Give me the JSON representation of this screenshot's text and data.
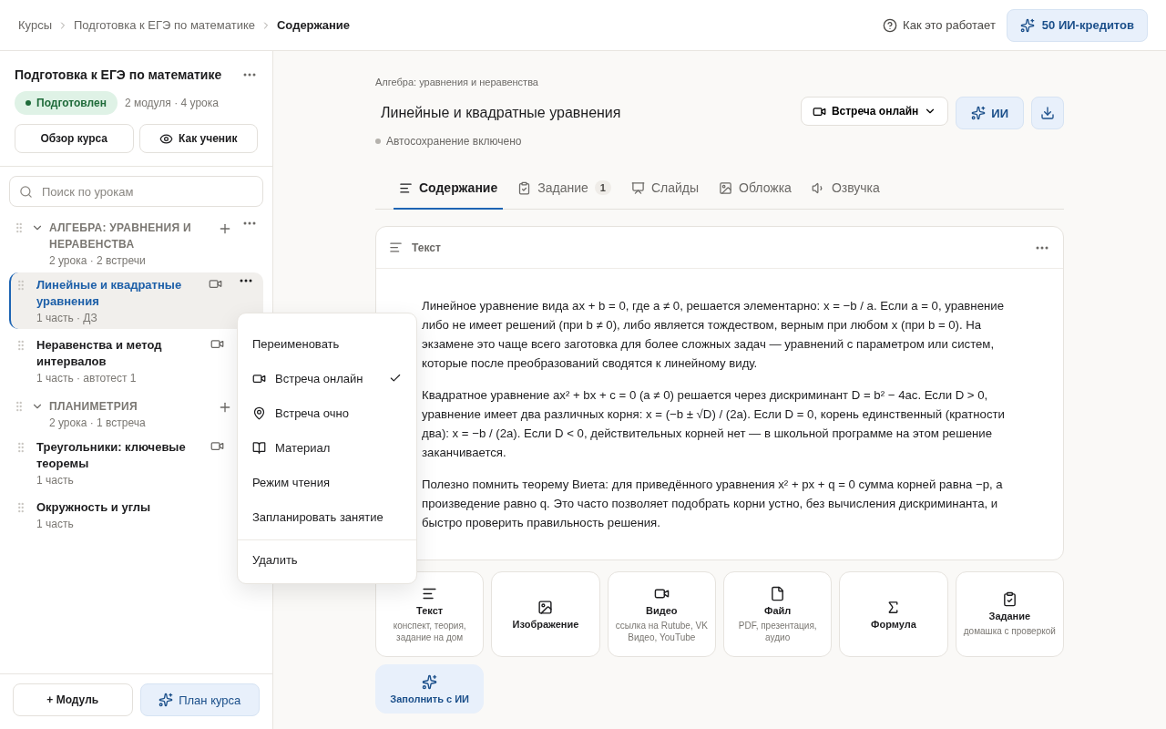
{
  "breadcrumbs": [
    {
      "label": "Курсы",
      "current": false
    },
    {
      "label": "Подготовка к ЕГЭ по математике",
      "current": false
    },
    {
      "label": "Содержание",
      "current": true
    }
  ],
  "header": {
    "help": "Как это работает",
    "credits": "50 ИИ-кредитов"
  },
  "sidebar": {
    "course_title": "Подготовка к ЕГЭ по математике",
    "status": "Подготовлен",
    "stats": "2 модуля · 4 урока",
    "overview_button": "Обзор курса",
    "student_button": "Как ученик",
    "search": {
      "placeholder": "Поиск по урокам"
    },
    "modules": [
      {
        "title": "АЛГЕБРА: УРАВНЕНИЯ И НЕРАВЕНСТВА",
        "meta": "2 урока · 2 встречи",
        "expanded": true,
        "has_more": true,
        "lessons": [
          {
            "title": "Линейные и квадратные уравнения",
            "meta": "1 часть · ДЗ",
            "video": true,
            "selected": true
          },
          {
            "title": "Неравенства и метод интервалов",
            "meta": "1 часть · автотест 1",
            "video": true,
            "selected": false
          }
        ]
      },
      {
        "title": "ПЛАНИМЕТРИЯ",
        "meta": "2 урока · 1 встреча",
        "expanded": true,
        "has_more": false,
        "lessons": [
          {
            "title": "Треугольники: ключевые теоремы",
            "meta": "1 часть",
            "video": true,
            "selected": false
          },
          {
            "title": "Окружность и углы",
            "meta": "1 часть",
            "video": false,
            "selected": false
          }
        ]
      }
    ],
    "add_module": "+ Модуль",
    "plan_button": "План курса"
  },
  "context_menu": [
    {
      "label": "Переименовать",
      "kind": "plain",
      "checked": false,
      "separated": false
    },
    {
      "label": "Встреча онлайн",
      "kind": "video",
      "checked": true,
      "separated": false
    },
    {
      "label": "Встреча очно",
      "kind": "pin",
      "checked": false,
      "separated": false
    },
    {
      "label": "Материал",
      "kind": "book",
      "checked": false,
      "separated": false
    },
    {
      "label": "Режим чтения",
      "kind": "plain",
      "checked": false,
      "separated": false
    },
    {
      "label": "Запланировать занятие",
      "kind": "plain",
      "checked": false,
      "separated": false
    },
    {
      "label": "Удалить",
      "kind": "plain",
      "checked": false,
      "separated": true
    }
  ],
  "lesson": {
    "module": "Алгебра: уравнения и неравенства",
    "title": "Линейные и квадратные уравнения",
    "autosave": "Автосохранение включено",
    "meeting_button": "Встреча онлайн",
    "ai_button": "ИИ",
    "tabs": [
      {
        "label": "Содержание",
        "kind": "lines",
        "selected": true
      },
      {
        "label": "Задание",
        "kind": "clipboard",
        "badge": "1",
        "selected": false
      },
      {
        "label": "Слайды",
        "kind": "slides",
        "selected": false
      },
      {
        "label": "Обложка",
        "kind": "image",
        "selected": false
      },
      {
        "label": "Озвучка",
        "kind": "sound",
        "selected": false
      }
    ],
    "block": {
      "title": "Текст",
      "paragraphs": [
        "Линейное уравнение вида ax + b = 0, где a ≠ 0, решается элементарно: x = −b / a. Если a = 0, уравнение либо не имеет решений (при b ≠ 0), либо является тождеством, верным при любом x (при b = 0). На экзамене это чаще всего заготовка для более сложных задач — уравнений с параметром или систем, которые после преобразований сводятся к линейному виду.",
        "Квадратное уравнение ax² + bx + c = 0 (a ≠ 0) решается через дискриминант D = b² − 4ac. Если D > 0, уравнение имеет два различных корня: x = (−b ± √D) / (2a). Если D = 0, корень единственный (кратности два): x = −b / (2a). Если D < 0, действительных корней нет — в школьной программе на этом решение заканчивается.",
        "Полезно помнить теорему Виета: для приведённого уравнения x² + px + q = 0 сумма корней равна −p, а произведение равно q. Это часто позволяет подобрать корни устно, без вычисления дискриминанта, и быстро проверить правильность решения."
      ]
    },
    "tiles": [
      {
        "kind": "lines",
        "title": "Текст",
        "hint": "конспект, теория, задание на дом"
      },
      {
        "kind": "image",
        "title": "Изображение"
      },
      {
        "kind": "video",
        "title": "Видео",
        "hint": "ссылка на Rutube, VK Видео, YouTube"
      },
      {
        "kind": "file",
        "title": "Файл",
        "hint": "PDF, презентация, аудио"
      },
      {
        "kind": "sigma",
        "title": "Формула"
      },
      {
        "kind": "clipboard",
        "title": "Задание",
        "hint": "домашка с проверкой"
      },
      {
        "kind": "ai",
        "title": "Заполнить с ИИ"
      }
    ]
  }
}
